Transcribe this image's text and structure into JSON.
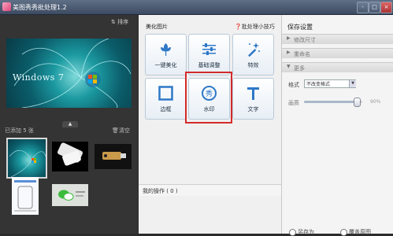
{
  "window": {
    "title": "美图秀秀批处理1.2",
    "buttons": [
      "-",
      "□",
      "×"
    ]
  },
  "left_panel": {
    "sort_label": "排序",
    "preview_caption": "Windows 7",
    "added_count_label": "已添加 5 张",
    "clear_label": "清空",
    "collapse_arrow": "▲"
  },
  "middle_panel": {
    "title": "美化图片",
    "tips_label": "批处理小技巧",
    "tools": [
      {
        "label": "一键美化",
        "icon": "flower-icon"
      },
      {
        "label": "基础调整",
        "icon": "sliders-icon"
      },
      {
        "label": "特效",
        "icon": "magic-wand-icon"
      },
      {
        "label": "边框",
        "icon": "frame-icon"
      },
      {
        "label": "水印",
        "icon": "watermark-icon"
      },
      {
        "label": "文字",
        "icon": "text-icon"
      }
    ],
    "my_operations_label": "我的操作 ( 0 )"
  },
  "right_panel": {
    "title": "保存设置",
    "sections": [
      {
        "label": "修改尺寸",
        "arrow": "▶"
      },
      {
        "label": "重命名",
        "arrow": "▶"
      },
      {
        "label": "更多",
        "arrow": "▼"
      }
    ],
    "format_label": "格式",
    "format_value": "不改变格式",
    "quality_label": "画质",
    "quality_value": "90%",
    "quality_level": 0.9,
    "save_as_label": "另存为",
    "cover_label": "覆盖原图"
  },
  "colors": {
    "highlight": "#d42a2a",
    "tile_icon": "#2e78c7"
  }
}
